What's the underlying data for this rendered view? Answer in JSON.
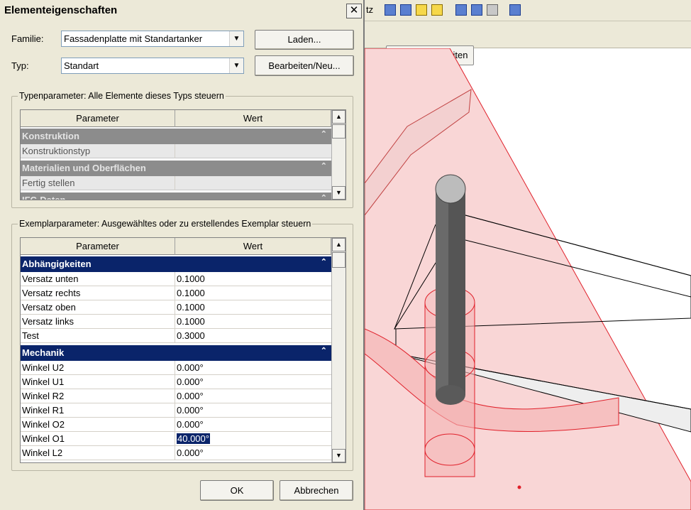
{
  "dialog": {
    "title": "Elementeigenschaften",
    "close_glyph": "✕",
    "family_label": "Familie:",
    "family_value": "Fassadenplatte mit Standartanker",
    "type_label": "Typ:",
    "type_value": "Standart",
    "load_button": "Laden...",
    "edit_new_button": "Bearbeiten/Neu...",
    "ok_button": "OK",
    "cancel_button": "Abbrechen"
  },
  "type_params": {
    "group_title": "Typenparameter: Alle Elemente dieses Typs steuern",
    "col_param": "Parameter",
    "col_value": "Wert",
    "categories": [
      {
        "name": "Konstruktion",
        "rows": [
          {
            "param": "Konstruktionstyp",
            "value": ""
          }
        ]
      },
      {
        "name": "Materialien und Oberflächen",
        "rows": [
          {
            "param": "Fertig stellen",
            "value": ""
          }
        ]
      },
      {
        "name": "IFC-Daten",
        "rows": []
      }
    ]
  },
  "instance_params": {
    "group_title": "Exemplarparameter: Ausgewähltes oder zu erstellendes Exemplar steuern",
    "col_param": "Parameter",
    "col_value": "Wert",
    "cat1": "Abhängigkeiten",
    "rows1": [
      {
        "param": "Versatz unten",
        "value": "0.1000"
      },
      {
        "param": "Versatz rechts",
        "value": "0.1000"
      },
      {
        "param": "Versatz oben",
        "value": "0.1000"
      },
      {
        "param": "Versatz links",
        "value": "0.1000"
      },
      {
        "param": "Test",
        "value": "0.3000"
      }
    ],
    "cat2": "Mechanik",
    "rows2": [
      {
        "param": "Winkel U2",
        "value": "0.000°"
      },
      {
        "param": "Winkel U1",
        "value": "0.000°"
      },
      {
        "param": "Winkel R2",
        "value": "0.000°"
      },
      {
        "param": "Winkel R1",
        "value": "0.000°"
      },
      {
        "param": "Winkel O2",
        "value": "0.000°"
      },
      {
        "param": "Winkel O1",
        "value": "40.000°"
      },
      {
        "param": "Winkel L2",
        "value": "0.000°"
      }
    ]
  },
  "app": {
    "toolbar_cut_text": "tz",
    "family_edit_button": "Familie bearbeiten"
  },
  "colors": {
    "dialog_bg": "#ece9d8",
    "category_selected": "#0a246a",
    "category_inactive": "#8c8c8c",
    "model_red": "#e0202a",
    "model_fill": "#f7c6c6"
  }
}
